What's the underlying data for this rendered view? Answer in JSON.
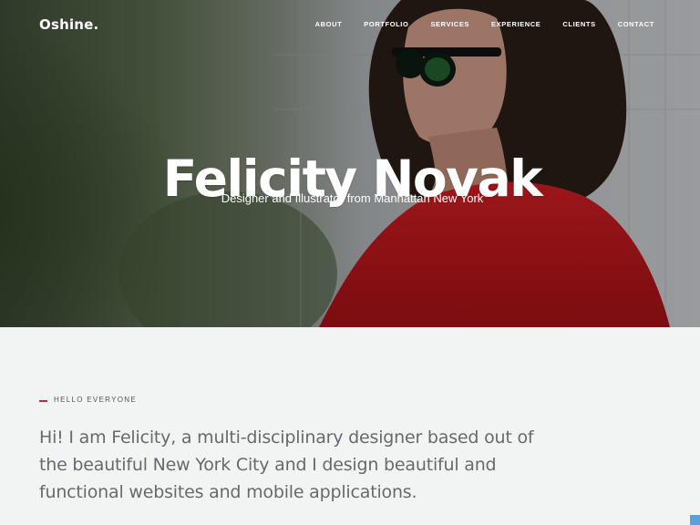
{
  "brand": {
    "logo": "Oshine."
  },
  "nav": {
    "items": [
      "ABOUT",
      "PORTFOLIO",
      "SERVICES",
      "EXPERIENCE",
      "CLIENTS",
      "CONTACT"
    ]
  },
  "hero": {
    "title": "Felicity Novak",
    "subtitle": "Designer and Illustrator from Manhattan New York"
  },
  "intro": {
    "label": "HELLO EVERYONE",
    "text": "Hi! I am Felicity, a multi-disciplinary designer based out of the beautiful New York City and I design beautiful and functional websites and mobile applications."
  },
  "colors": {
    "accent": "#e0242b",
    "scroll_button": "#5aa0dc",
    "background": "#f2f3f3"
  }
}
